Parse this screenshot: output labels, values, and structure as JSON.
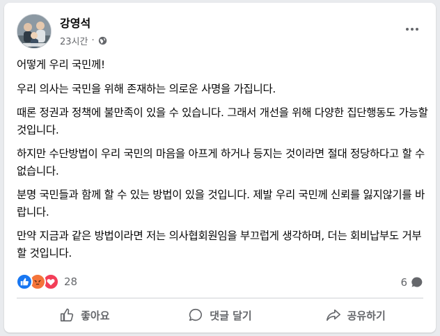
{
  "post": {
    "author": "강영석",
    "time": "23시간",
    "dot": "·",
    "paragraphs": [
      "어떻게 우리 국민께!",
      "우리 의사는 국민을 위해 존재하는 의로운 사명을 가집니다.",
      "때론 정권과 정책에 불만족이 있을 수 있습니다. 그래서 개선을 위해 다양한 집단행동도 가능할 것입니다.",
      "하지만 수단방법이 우리 국민의 마음을 아프게 하거나 등지는 것이라면 절대 정당하다고 할 수 없습니다.",
      "분명 국민들과 함께 할 수 있는 방법이 있을 것입니다. 제발 우리 국민께 신뢰를 잃지않기를 바랍니다.",
      "만약 지금과 같은 방법이라면 저는 의사협회원임을 부끄럽게 생각하며, 더는 회비납부도 거부할 것입니다."
    ],
    "privacy_icon": "globe-icon"
  },
  "reactions": {
    "icons": [
      "like-icon",
      "angry-icon",
      "love-icon"
    ],
    "count": "28"
  },
  "comments": {
    "count": "6"
  },
  "actions": {
    "like": "좋아요",
    "comment": "댓글 달기",
    "share": "공유하기"
  },
  "colors": {
    "like_blue": "#1877f2",
    "angry_orange": "#f4743a",
    "love_red": "#f33e58",
    "secondary_text": "#65676b"
  }
}
